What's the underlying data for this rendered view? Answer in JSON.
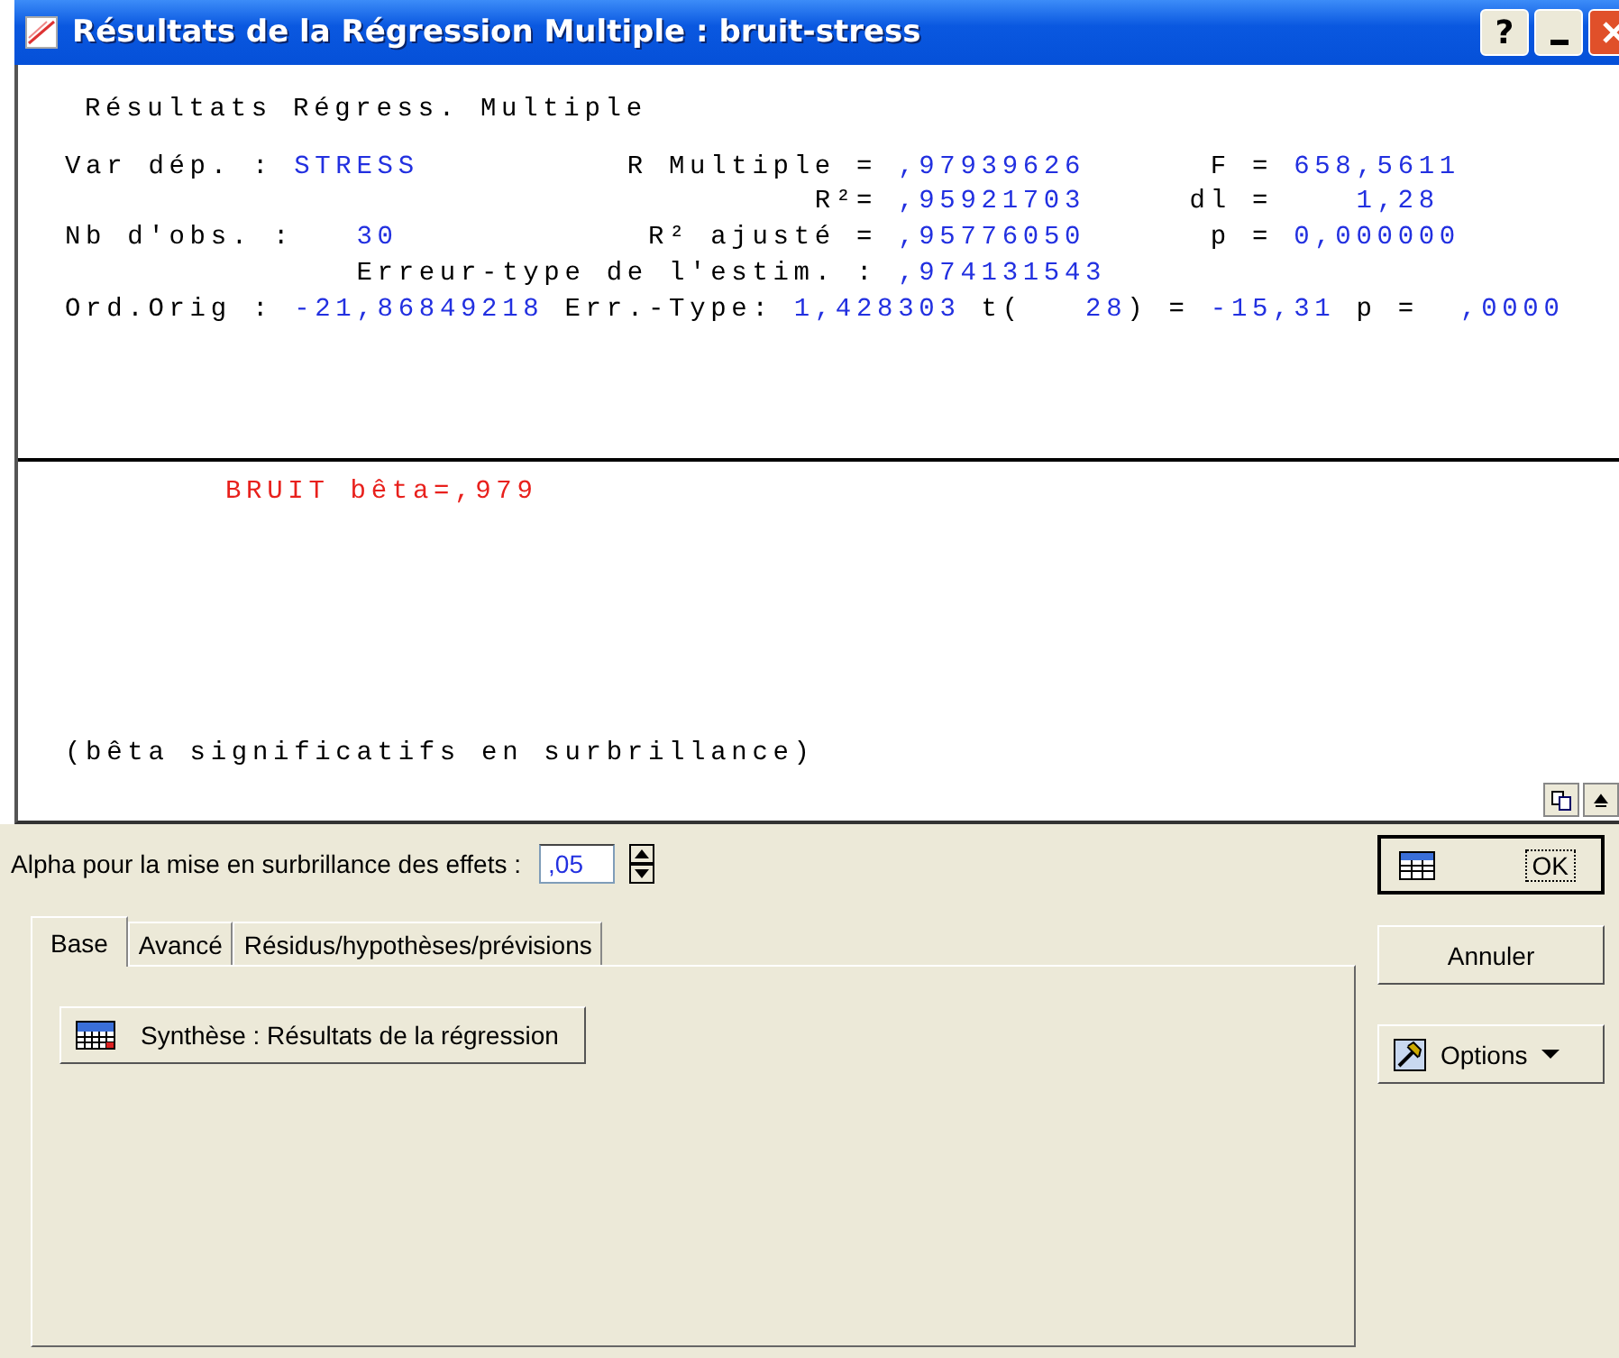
{
  "window": {
    "title": "Résultats de la Régression Multiple : bruit-stress",
    "help_button": "?"
  },
  "results": {
    "heading": "Résultats Régress. Multiple",
    "lines": [
      [
        {
          "text": "Var dép. : ",
          "kind": "label"
        },
        {
          "text": "STRESS",
          "kind": "value"
        },
        {
          "text": "          R Multiple = ",
          "kind": "label"
        },
        {
          "text": ",97939626",
          "kind": "value"
        },
        {
          "text": "      F = ",
          "kind": "label"
        },
        {
          "text": "658,5611",
          "kind": "value"
        }
      ],
      [
        {
          "text": "                                    R²= ",
          "kind": "label"
        },
        {
          "text": ",95921703",
          "kind": "value"
        },
        {
          "text": "     dl =    ",
          "kind": "label"
        },
        {
          "text": "1,28",
          "kind": "value"
        }
      ],
      [
        {
          "text": "Nb d'obs. :   ",
          "kind": "label"
        },
        {
          "text": "30",
          "kind": "value"
        },
        {
          "text": "            R² ajusté = ",
          "kind": "label"
        },
        {
          "text": ",95776050",
          "kind": "value"
        },
        {
          "text": "      p = ",
          "kind": "label"
        },
        {
          "text": "0,000000",
          "kind": "value"
        }
      ],
      [
        {
          "text": "              Erreur-type de l'estim. : ",
          "kind": "label"
        },
        {
          "text": ",974131543",
          "kind": "value"
        }
      ],
      [
        {
          "text": "Ord.Orig : ",
          "kind": "label"
        },
        {
          "text": "-21,86849218",
          "kind": "value"
        },
        {
          "text": " Err.-Type: ",
          "kind": "label"
        },
        {
          "text": "1,428303",
          "kind": "value"
        },
        {
          "text": " t(",
          "kind": "label"
        },
        {
          "text": "   28",
          "kind": "value"
        },
        {
          "text": ") = ",
          "kind": "label"
        },
        {
          "text": "-15,31",
          "kind": "value"
        },
        {
          "text": " p =  ",
          "kind": "label"
        },
        {
          "text": ",0000",
          "kind": "value"
        }
      ]
    ],
    "betas": [
      {
        "text": "BRUIT bêta=,979",
        "significant": true
      }
    ],
    "footnote": "(bêta significatifs en surbrillance)"
  },
  "alpha": {
    "label": "Alpha pour la mise en surbrillance des effets :",
    "value": ",05"
  },
  "tabs": [
    {
      "label": "Base",
      "selected": true
    },
    {
      "label": "Avancé",
      "selected": false
    },
    {
      "label": "Résidus/hypothèses/prévisions",
      "selected": false
    }
  ],
  "tab_buttons": [
    "Synthèse :  Résultats de la régression"
  ],
  "buttons": [
    {
      "label": "OK",
      "kind": "ok"
    },
    {
      "label": "Annuler",
      "kind": "plain"
    },
    {
      "label": "Options",
      "kind": "menu"
    }
  ]
}
